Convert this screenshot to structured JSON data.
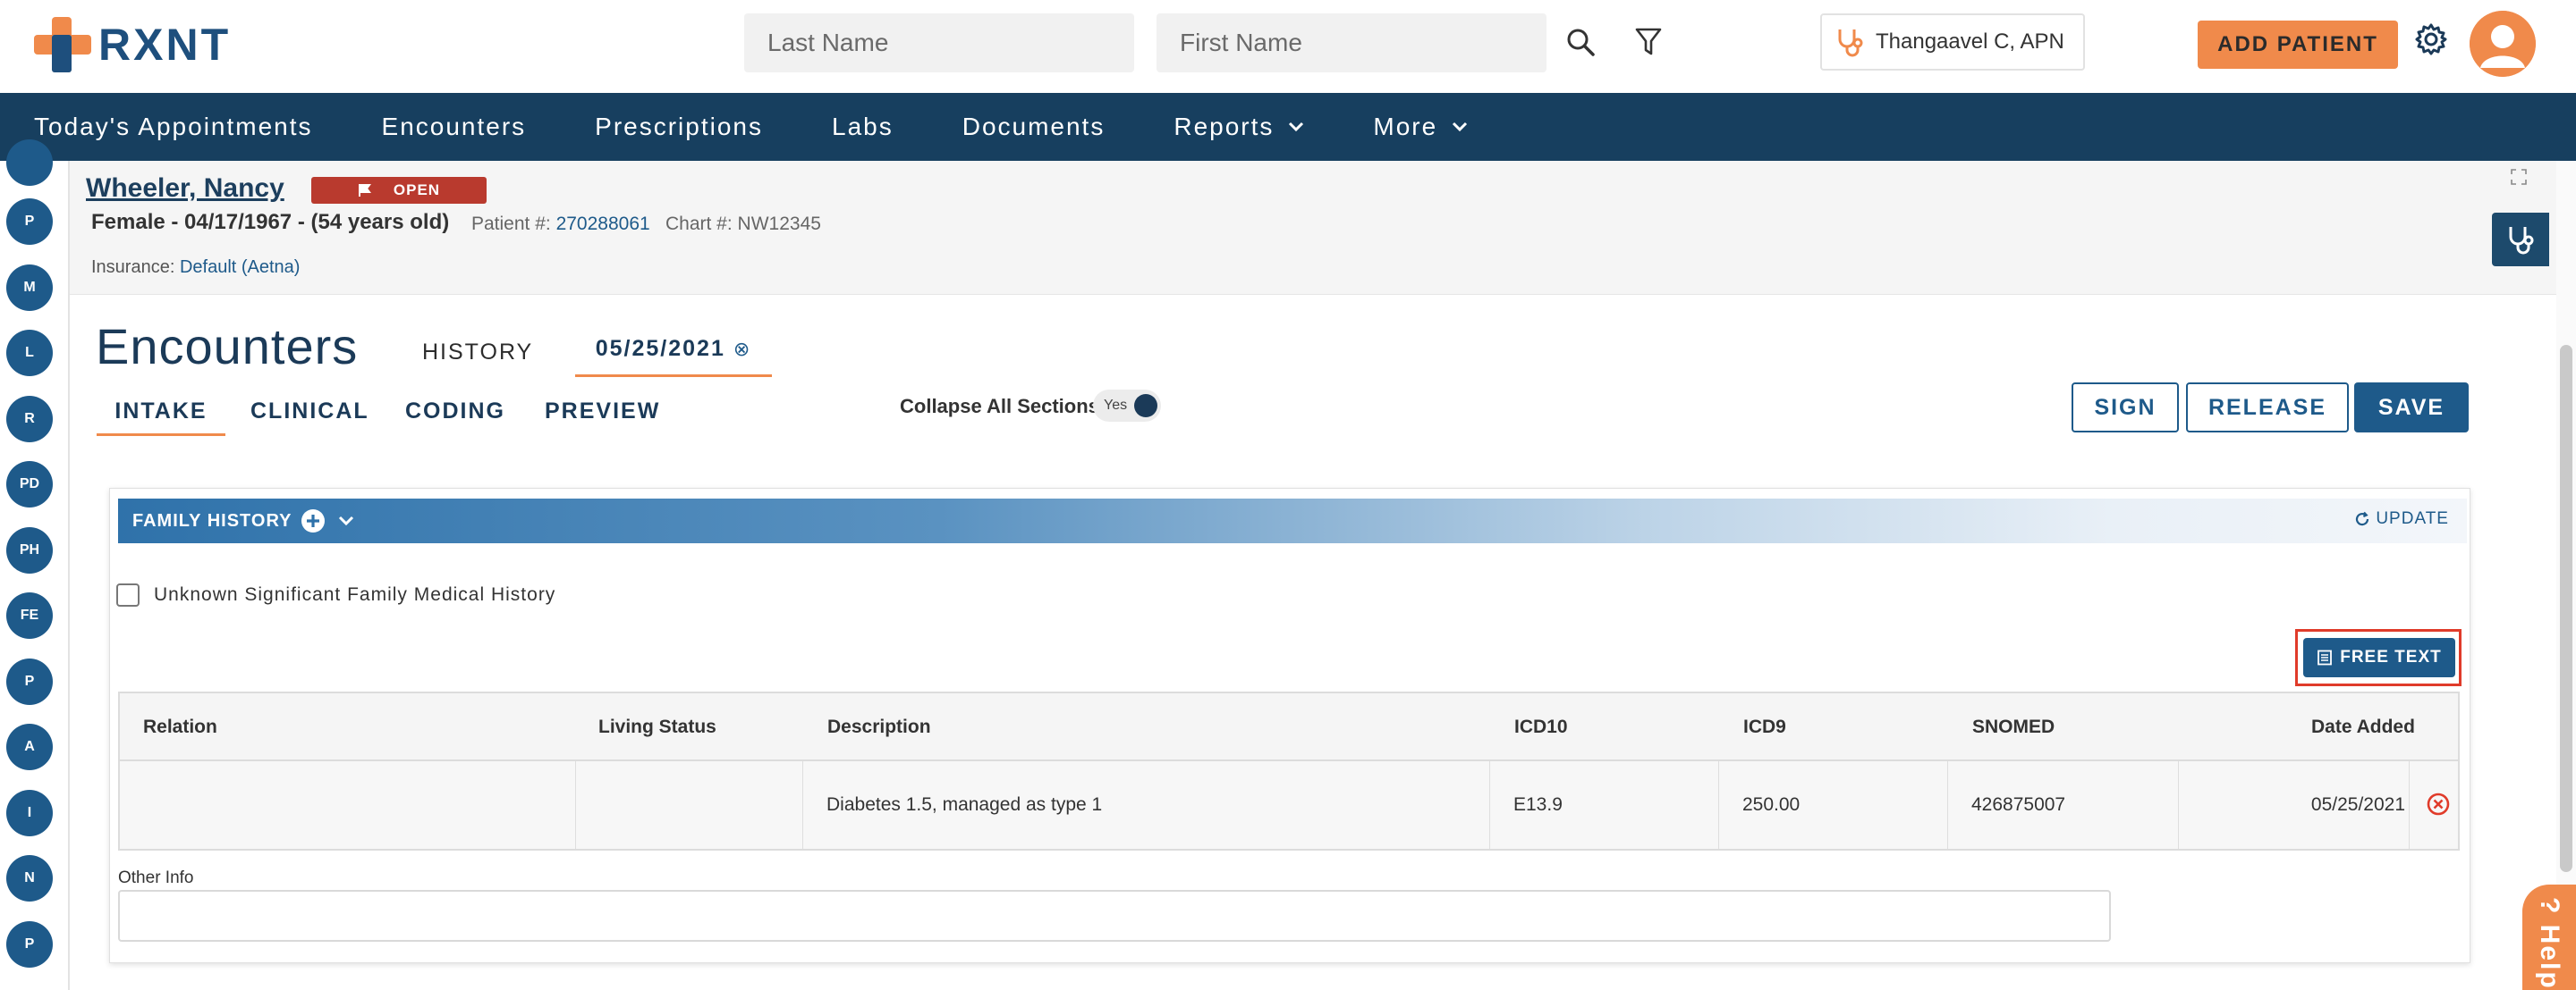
{
  "header": {
    "logo_text": "RXNT",
    "last_name_placeholder": "Last Name",
    "first_name_placeholder": "First Name",
    "provider": "Thangaavel C, APN",
    "add_patient": "ADD PATIENT"
  },
  "nav": {
    "items": [
      {
        "label": "Today's Appointments",
        "dropdown": false
      },
      {
        "label": "Encounters",
        "dropdown": false
      },
      {
        "label": "Prescriptions",
        "dropdown": false
      },
      {
        "label": "Labs",
        "dropdown": false
      },
      {
        "label": "Documents",
        "dropdown": false
      },
      {
        "label": "Reports",
        "dropdown": true
      },
      {
        "label": "More",
        "dropdown": true
      }
    ]
  },
  "rail": {
    "buttons": [
      "P",
      "M",
      "L",
      "R",
      "PD",
      "PH",
      "FE",
      "P",
      "A",
      "I",
      "N",
      "P"
    ]
  },
  "patient": {
    "name": "Wheeler, Nancy",
    "status": "OPEN",
    "demographics": "Female - 04/17/1967 - (54 years old)",
    "patient_label": "Patient #:",
    "patient_number": "270288061",
    "chart_label": "Chart #:",
    "chart_number": "NW12345",
    "insurance_label": "Insurance:",
    "insurance_value": "Default (Aetna)"
  },
  "encounter": {
    "title": "Encounters",
    "history_tab": "HISTORY",
    "date_tab": "05/25/2021",
    "date_tab_close": "⊗",
    "subtabs": [
      "INTAKE",
      "CLINICAL",
      "CODING",
      "PREVIEW"
    ],
    "collapse_label": "Collapse All Sections:",
    "collapse_toggle": "Yes",
    "sign": "SIGN",
    "release": "RELEASE",
    "save": "SAVE"
  },
  "family_history": {
    "title": "FAMILY HISTORY",
    "update": "UPDATE",
    "unknown_label": "Unknown Significant Family Medical History",
    "unknown_checked": false,
    "free_text": "FREE TEXT",
    "columns": [
      "Relation",
      "Living Status",
      "Description",
      "ICD10",
      "ICD9",
      "SNOMED",
      "Date Added"
    ],
    "rows": [
      {
        "relation": "",
        "living_status": "",
        "description": "Diabetes 1.5, managed as type 1",
        "icd10": "E13.9",
        "icd9": "250.00",
        "snomed": "426875007",
        "date_added": "05/25/2021"
      }
    ],
    "other_info_label": "Other Info",
    "other_info_value": ""
  },
  "help": {
    "label": "Help",
    "glyph": "?"
  },
  "colors": {
    "brand_navy": "#173f5f",
    "brand_blue": "#1e5a8a",
    "accent_orange": "#f08a4b",
    "open_red": "#b93a2e",
    "highlight_red": "#e03b2a"
  }
}
